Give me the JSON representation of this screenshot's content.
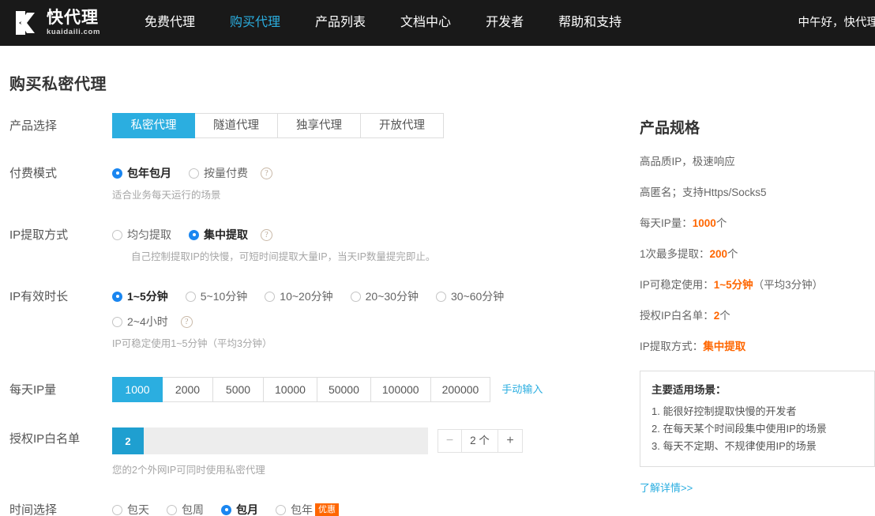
{
  "header": {
    "logo_cn": "快代理",
    "logo_en": "kuaidaili.com",
    "nav": [
      {
        "label": "免费代理",
        "active": false
      },
      {
        "label": "购买代理",
        "active": true
      },
      {
        "label": "产品列表",
        "active": false
      },
      {
        "label": "文档中心",
        "active": false
      },
      {
        "label": "开发者",
        "active": false
      },
      {
        "label": "帮助和支持",
        "active": false
      }
    ],
    "greeting": "中午好，快代理"
  },
  "page": {
    "title": "购买私密代理"
  },
  "rows": {
    "product": {
      "label": "产品选择",
      "options": [
        "私密代理",
        "隧道代理",
        "独享代理",
        "开放代理"
      ],
      "selected": "私密代理"
    },
    "billing": {
      "label": "付费模式",
      "options": [
        "包年包月",
        "按量付费"
      ],
      "selected": "包年包月",
      "help": "?",
      "hint": "适合业务每天运行的场景"
    },
    "extract": {
      "label": "IP提取方式",
      "options": [
        "均匀提取",
        "集中提取"
      ],
      "selected": "集中提取",
      "help": "?",
      "hint": "自己控制提取IP的快慢，可短时间提取大量IP，当天IP数量提完即止。"
    },
    "duration": {
      "label": "IP有效时长",
      "options_row1": [
        "1~5分钟",
        "5~10分钟",
        "10~20分钟",
        "20~30分钟",
        "30~60分钟"
      ],
      "options_row2": [
        "2~4小时"
      ],
      "selected": "1~5分钟",
      "help": "?",
      "hint": "IP可稳定使用1~5分钟（平均3分钟）"
    },
    "daily_ip": {
      "label": "每天IP量",
      "options": [
        "1000",
        "2000",
        "5000",
        "10000",
        "50000",
        "100000",
        "200000"
      ],
      "selected": "1000",
      "manual_link": "手动输入"
    },
    "whitelist": {
      "label": "授权IP白名单",
      "bar_value": "2",
      "stepper_minus": "−",
      "stepper_value": "2 个",
      "stepper_plus": "+",
      "hint": "您的2个外网IP可同时使用私密代理"
    },
    "time": {
      "label": "时间选择",
      "options": [
        "包天",
        "包周",
        "包月",
        "包年"
      ],
      "selected": "包月",
      "badge_on": "包年",
      "badge": "优惠"
    }
  },
  "sidebar": {
    "title": "产品规格",
    "specs": [
      {
        "text": "高品质IP，极速响应",
        "label": "",
        "value": "",
        "suffix": ""
      },
      {
        "text": "高匿名；支持Https/Socks5",
        "label": "",
        "value": "",
        "suffix": ""
      },
      {
        "text": "",
        "label": "每天IP量：",
        "value": "1000",
        "suffix": "个"
      },
      {
        "text": "",
        "label": "1次最多提取：",
        "value": "200",
        "suffix": "个"
      },
      {
        "text": "",
        "label": "IP可稳定使用：",
        "value": "1~5分钟",
        "suffix": "（平均3分钟）"
      },
      {
        "text": "",
        "label": "授权IP白名单：",
        "value": "2",
        "suffix": "个"
      },
      {
        "text": "",
        "label": "IP提取方式：",
        "value": "集中提取",
        "suffix": ""
      }
    ],
    "scenario_box": {
      "title": "主要适用场景：",
      "items": [
        "1. 能很好控制提取快慢的开发者",
        "2. 在每天某个时间段集中使用IP的场景",
        "3. 每天不定期、不规律使用IP的场景"
      ]
    },
    "more_link": "了解详情>>"
  },
  "colors": {
    "accent": "#2baee0",
    "highlight": "#ff6600",
    "radio_blue": "#1a86f0",
    "header_bg": "#191919"
  }
}
